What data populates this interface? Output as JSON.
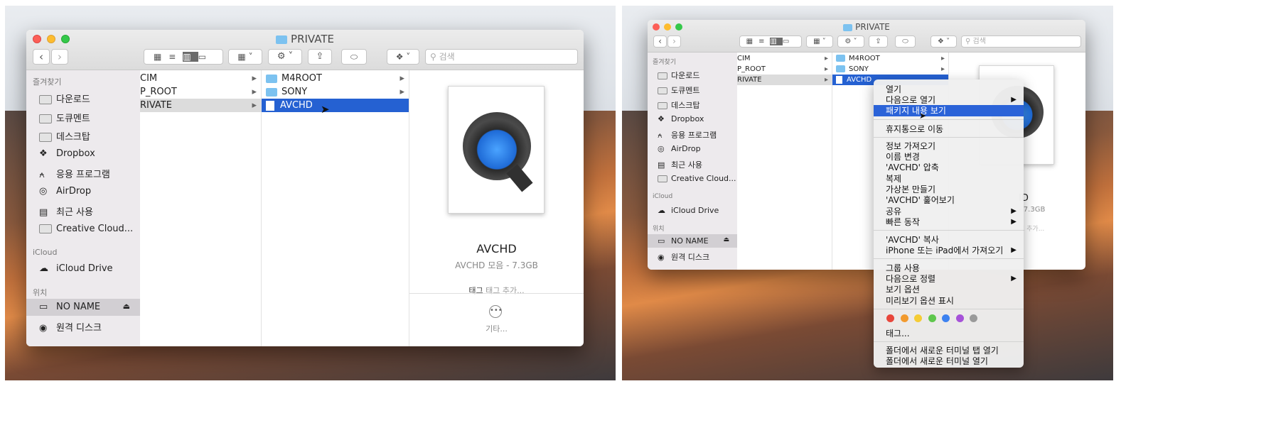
{
  "left": {
    "window_title": "PRIVATE",
    "search_placeholder": "검색",
    "sidebar": {
      "favorites_header": "즐겨찾기",
      "items": [
        "다운로드",
        "도큐멘트",
        "데스크탑",
        "Dropbox",
        "응용 프로그램",
        "AirDrop",
        "최근 사용",
        "Creative Cloud..."
      ],
      "icloud_header": "iCloud",
      "icloud_item": "iCloud Drive",
      "locations_header": "위치",
      "locations": [
        "NO NAME",
        "원격 디스크"
      ]
    },
    "col1": [
      "CIM",
      "P_ROOT",
      "RIVATE"
    ],
    "col2": [
      "M4ROOT",
      "SONY",
      "AVCHD"
    ],
    "preview": {
      "name": "AVCHD",
      "info": "AVCHD 모음 - 7.3GB",
      "tag_label": "태그",
      "tag_placeholder": "태그 추가...",
      "more": "기타..."
    }
  },
  "right": {
    "window_title": "PRIVATE",
    "search_placeholder": "검색",
    "sidebar": {
      "favorites_header": "즐겨찾기",
      "items": [
        "다운로드",
        "도큐멘트",
        "데스크탑",
        "Dropbox",
        "응용 프로그램",
        "AirDrop",
        "최근 사용",
        "Creative Cloud..."
      ],
      "icloud_header": "iCloud",
      "icloud_item": "iCloud Drive",
      "locations_header": "위치",
      "locations": [
        "NO NAME",
        "원격 디스크"
      ]
    },
    "col1": [
      "CIM",
      "P_ROOT",
      "RIVATE"
    ],
    "col2": [
      "M4ROOT",
      "SONY",
      "AVCHD"
    ],
    "preview": {
      "name_fragment": "ID",
      "info_fragment": "- 7.3GB",
      "tag_fragment": "그 추가..."
    },
    "context_menu": {
      "items": [
        {
          "label": "열기"
        },
        {
          "label": "다음으로 열기",
          "submenu": true
        },
        {
          "label": "패키지 내용 보기",
          "highlighted": true
        },
        {
          "label": "휴지통으로 이동"
        },
        {
          "label": "정보 가져오기"
        },
        {
          "label": "이름 변경"
        },
        {
          "label": "'AVCHD' 압축"
        },
        {
          "label": "복제"
        },
        {
          "label": "가상본 만들기"
        },
        {
          "label": "'AVCHD' 훑어보기"
        },
        {
          "label": "공유",
          "submenu": true
        },
        {
          "label": "빠른 동작",
          "submenu": true
        },
        {
          "label": "'AVCHD' 복사"
        },
        {
          "label": "iPhone 또는 iPad에서 가져오기",
          "submenu": true
        },
        {
          "label": "그룹 사용"
        },
        {
          "label": "다음으로 정렬",
          "submenu": true
        },
        {
          "label": "보기 옵션"
        },
        {
          "label": "미리보기 옵션 표시"
        },
        {
          "label": "태그..."
        },
        {
          "label": "폴더에서 새로운 터미널 탭 열기"
        },
        {
          "label": "폴더에서 새로운 터미널 열기"
        }
      ],
      "tag_colors": [
        "#e8463c",
        "#f29a2e",
        "#f5cc35",
        "#5fc74c",
        "#3d82f0",
        "#a652d8",
        "#9a9a9a"
      ]
    }
  }
}
